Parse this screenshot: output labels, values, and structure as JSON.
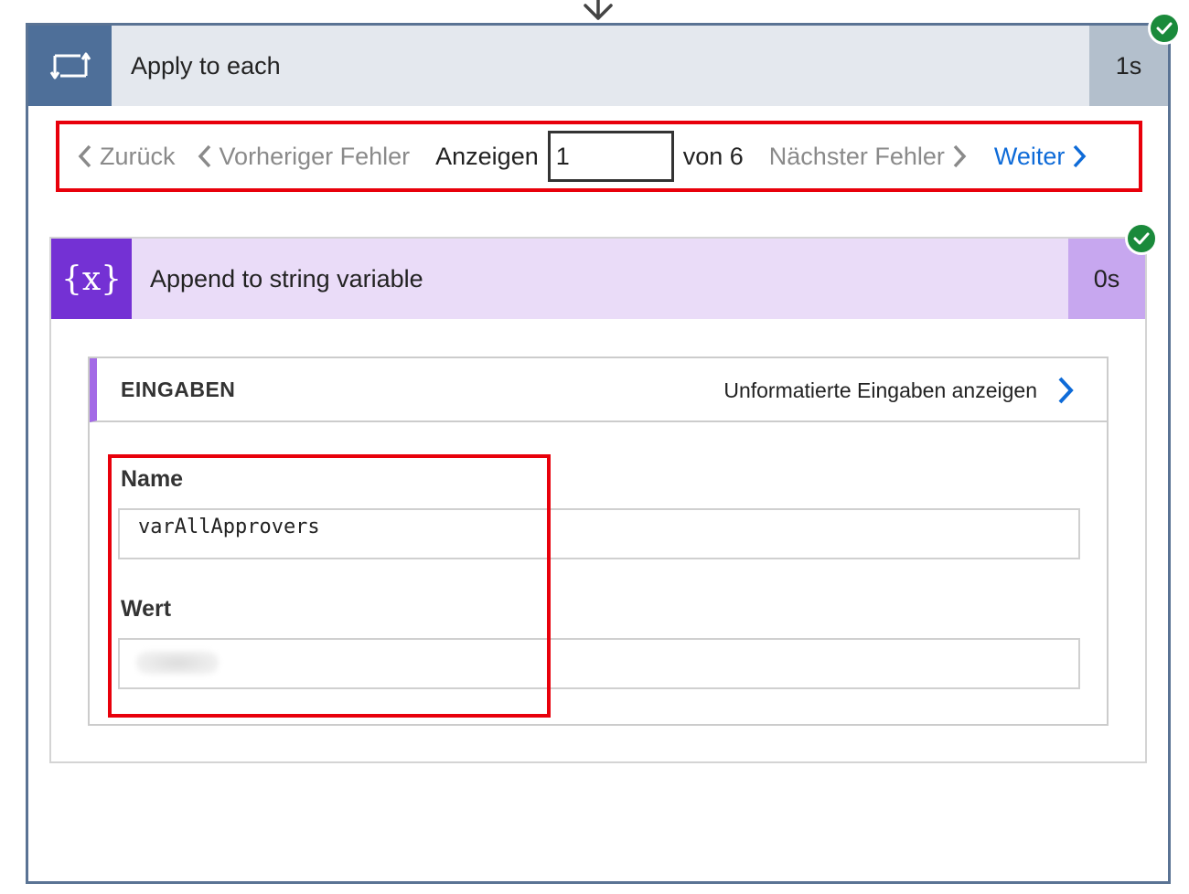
{
  "outer": {
    "title": "Apply to each",
    "duration": "1s",
    "icon": "loop-icon",
    "status": "success"
  },
  "pager": {
    "back_label": "Zurück",
    "prev_error_label": "Vorheriger Fehler",
    "show_label": "Anzeigen",
    "page_value": "1",
    "of_label": "von 6",
    "next_error_label": "Nächster Fehler",
    "next_label": "Weiter"
  },
  "inner": {
    "title": "Append to string variable",
    "duration": "0s",
    "icon": "variable-icon",
    "icon_text": "{x}",
    "status": "success"
  },
  "inputs": {
    "title": "EINGABEN",
    "raw_link_label": "Unformatierte Eingaben anzeigen",
    "fields": [
      {
        "label": "Name",
        "value": "varAllApprovers"
      },
      {
        "label": "Wert",
        "value": ""
      }
    ]
  },
  "colors": {
    "outer_accent": "#4e6f99",
    "inner_accent": "#7431d4",
    "success": "#1a8a3b",
    "link_blue": "#0e6bd8",
    "highlight_red": "#e8000b"
  }
}
